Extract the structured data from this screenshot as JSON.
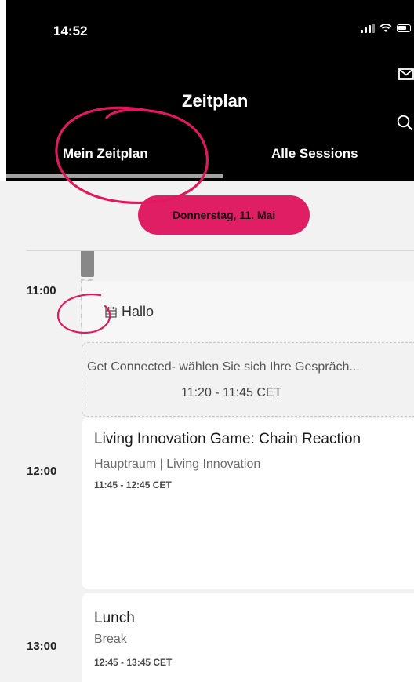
{
  "status_bar": {
    "time": "14:52",
    "icons": [
      "signal-icon",
      "wifi-icon",
      "battery-icon"
    ]
  },
  "header": {
    "title": "Zeitplan",
    "icons": [
      "mail-icon",
      "search-icon"
    ],
    "tabs": [
      {
        "label": "Mein Zeitplan",
        "active": true
      },
      {
        "label": "Alle Sessions",
        "active": false
      }
    ]
  },
  "date_selector": {
    "label": "Donnerstag, 11. Mai",
    "color": "#e01e63"
  },
  "timeline": {
    "hours": [
      "11:00",
      "12:00",
      "13:00"
    ]
  },
  "schedule": {
    "hallo": {
      "title": "Hallo",
      "icon": "calendar-icon"
    },
    "suggestion": {
      "title": "Get Connected- wählen Sie sich Ihre Gespräch...",
      "time": "11:20 - 11:45 CET"
    },
    "sessions": [
      {
        "title": "Living Innovation Game: Chain Reaction",
        "subtitle": "Hauptraum | Living Innovation",
        "time": "11:45 - 12:45 CET"
      },
      {
        "title": "Lunch",
        "subtitle": "Break",
        "time": "12:45 - 13:45 CET"
      }
    ]
  },
  "colors": {
    "header_bg": "#000000",
    "accent": "#e01e63",
    "annotation": "#e0195e"
  }
}
